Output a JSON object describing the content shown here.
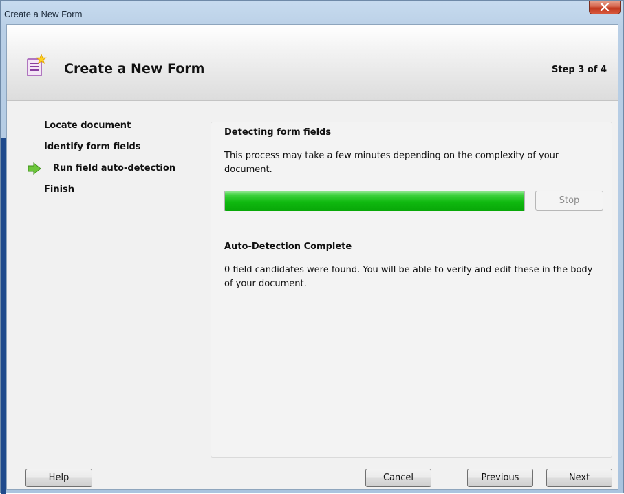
{
  "window": {
    "title": "Create a New Form"
  },
  "header": {
    "title": "Create a New Form",
    "step": "Step 3 of 4",
    "icon": "form-wizard-icon"
  },
  "nav": {
    "items": [
      {
        "label": "Locate document",
        "current": false
      },
      {
        "label": "Identify form fields",
        "current": false
      },
      {
        "label": "Run field auto-detection",
        "current": true
      },
      {
        "label": "Finish",
        "current": false
      }
    ],
    "current_indicator_icon": "arrow-right-icon"
  },
  "detect": {
    "title": "Detecting form fields",
    "description": "This process may take a few minutes depending on the complexity of your document.",
    "progress": 1.0,
    "stop_label": "Stop"
  },
  "complete": {
    "title": "Auto-Detection Complete",
    "description": "0 field candidates were found. You will be able to verify and edit these in the body of your document."
  },
  "buttons": {
    "help": "Help",
    "cancel": "Cancel",
    "previous": "Previous",
    "next": "Next"
  },
  "colors": {
    "progress": "#10b910",
    "close_button": "#c7432a",
    "arrow": "#5fc22e"
  }
}
